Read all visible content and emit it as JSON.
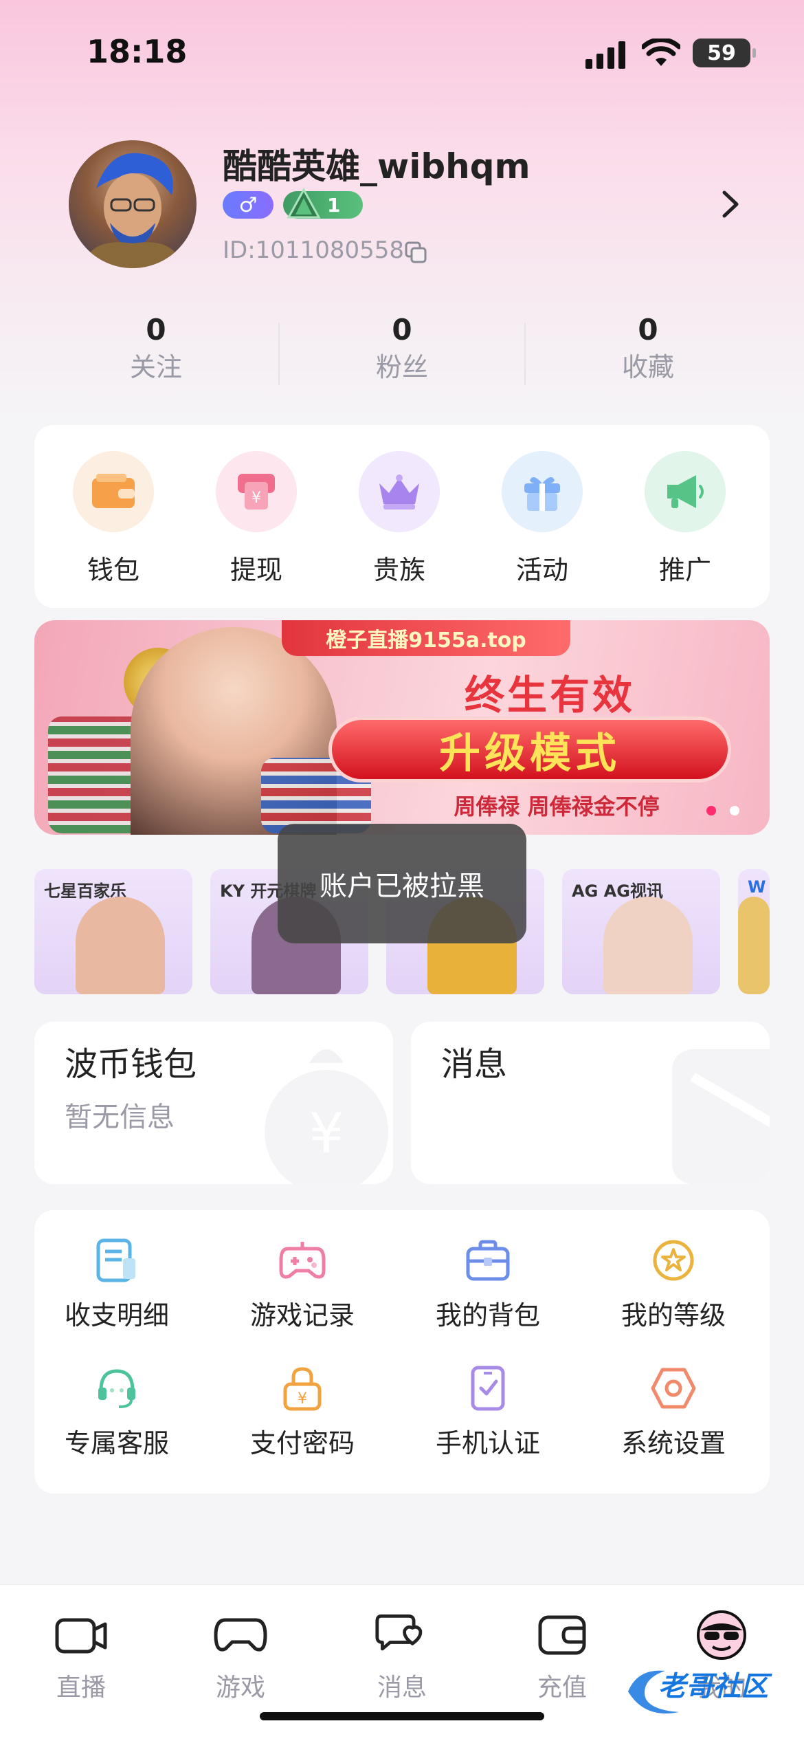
{
  "status_bar": {
    "time": "18:18",
    "battery": "59"
  },
  "profile": {
    "username": "酷酷英雄_wibhqm",
    "gender_symbol": "♂",
    "level": "1",
    "user_id": "ID:1011080558"
  },
  "stats": [
    {
      "value": "0",
      "label": "关注"
    },
    {
      "value": "0",
      "label": "粉丝"
    },
    {
      "value": "0",
      "label": "收藏"
    }
  ],
  "quick_actions": [
    {
      "label": "钱包",
      "icon": "wallet-icon",
      "color": "#f7a04a",
      "bg": "#fdeee2"
    },
    {
      "label": "提现",
      "icon": "withdraw-icon",
      "color": "#f06d8e",
      "bg": "#fde6ee"
    },
    {
      "label": "贵族",
      "icon": "crown-icon",
      "color": "#a884ef",
      "bg": "#f1e8fd"
    },
    {
      "label": "活动",
      "icon": "gift-icon",
      "color": "#7fb0f7",
      "bg": "#e5f0fd"
    },
    {
      "label": "推广",
      "icon": "megaphone-icon",
      "color": "#56c487",
      "bg": "#e1f5ea"
    }
  ],
  "banner": {
    "top_text": "橙子直播9155a.top",
    "headline": "终生有效",
    "pill_text": "升级模式",
    "subtext": "周俸禄 周俸禄金不停"
  },
  "games": [
    {
      "label": "七星百家乐",
      "color": "#e8b9a0"
    },
    {
      "label": "KY 开元棋牌",
      "color": "#8a6b8f"
    },
    {
      "label": "",
      "color": "#e8b23a"
    },
    {
      "label": "AG AG视讯",
      "color": "#f0d2c4"
    },
    {
      "label": "W",
      "color": "#e9c46a"
    }
  ],
  "toast": "账户已被拉黑",
  "wallet_card": {
    "title": "波币钱包",
    "subtitle": "暂无信息"
  },
  "message_card": {
    "title": "消息"
  },
  "menu": [
    {
      "label": "收支明细",
      "icon": "ledger-icon",
      "color": "#5bb4e6"
    },
    {
      "label": "游戏记录",
      "icon": "gamepad-icon",
      "color": "#ee7ea2"
    },
    {
      "label": "我的背包",
      "icon": "backpack-icon",
      "color": "#6c8ee8"
    },
    {
      "label": "我的等级",
      "icon": "star-badge-icon",
      "color": "#e9b33d"
    },
    {
      "label": "专属客服",
      "icon": "headset-icon",
      "color": "#4cc39a"
    },
    {
      "label": "支付密码",
      "icon": "lock-icon",
      "color": "#f0a340"
    },
    {
      "label": "手机认证",
      "icon": "phone-check-icon",
      "color": "#a78be6"
    },
    {
      "label": "系统设置",
      "icon": "settings-hex-icon",
      "color": "#f08a6a"
    }
  ],
  "tabs": [
    {
      "label": "直播",
      "icon": "live-camera-icon"
    },
    {
      "label": "游戏",
      "icon": "gamepad-tab-icon"
    },
    {
      "label": "消息",
      "icon": "chat-tab-icon"
    },
    {
      "label": "充值",
      "icon": "wallet-tab-icon"
    },
    {
      "label": "我的",
      "icon": "me-avatar-icon"
    }
  ],
  "watermark": "老哥社区"
}
